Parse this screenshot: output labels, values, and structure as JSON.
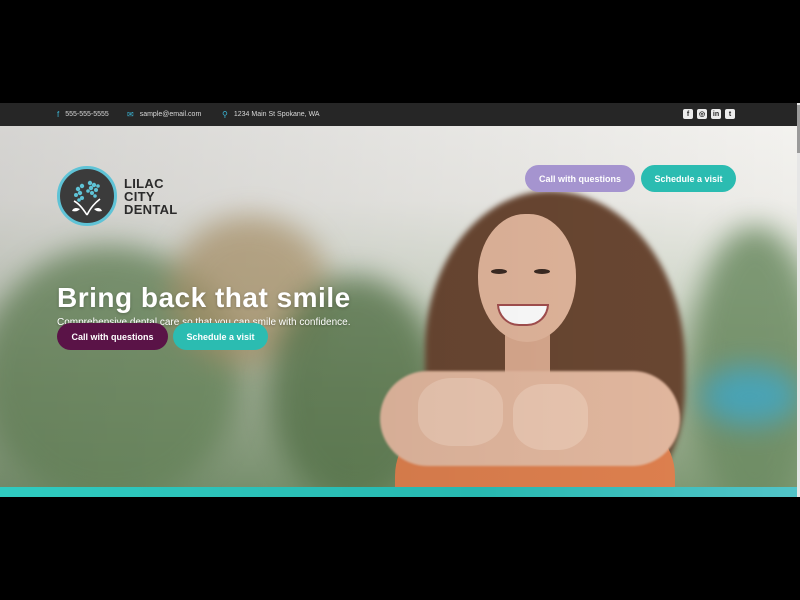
{
  "topbar": {
    "phone": "555-555-5555",
    "email": "sample@email.com",
    "address": "1234 Main St Spokane, WA",
    "phone_icon": "facebook-f-icon",
    "email_icon": "envelope-icon",
    "address_icon": "map-pin-icon",
    "social": [
      "facebook-icon",
      "instagram-icon",
      "linkedin-icon",
      "twitter-icon"
    ]
  },
  "logo": {
    "line1": "LILAC",
    "line2": "CITY",
    "line3": "DENTAL"
  },
  "header": {
    "call_label": "Call with questions",
    "schedule_label": "Schedule a visit"
  },
  "hero": {
    "headline": "Bring back that smile",
    "subline": "Comprehensive dental care so that you can smile with confidence.",
    "call_label": "Call with questions",
    "schedule_label": "Schedule a visit"
  },
  "colors": {
    "lilac": "#a594cf",
    "teal": "#2bbcb1",
    "plum": "#5a1347",
    "topbar": "#262626"
  }
}
